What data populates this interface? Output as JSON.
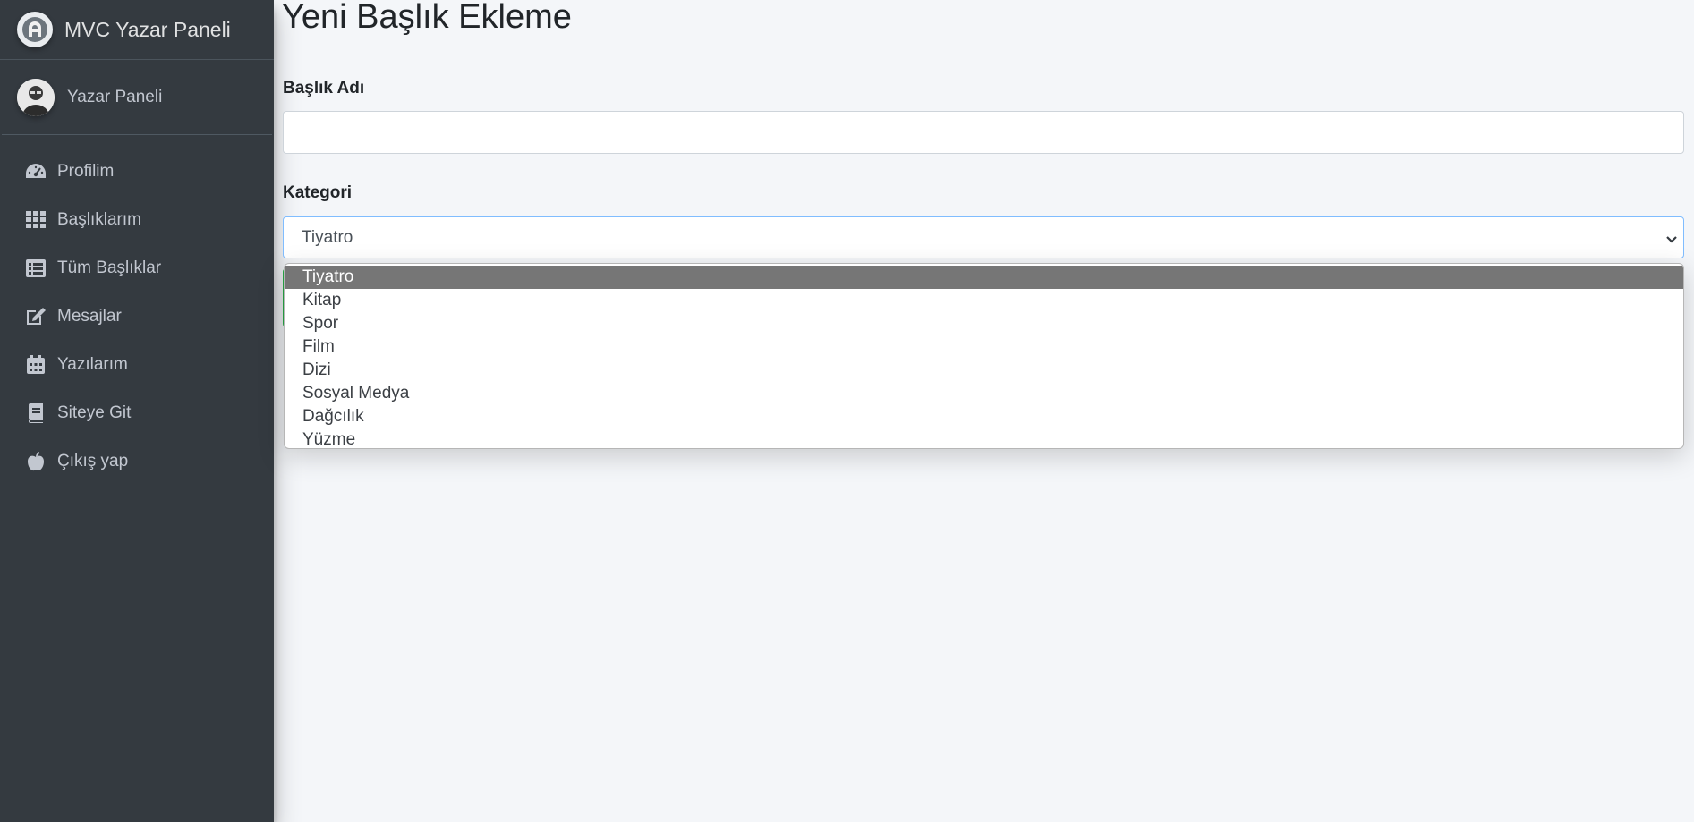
{
  "sidebar": {
    "brand": "MVC Yazar Paneli",
    "user_name": "Yazar Paneli",
    "items": [
      {
        "label": "Profilim",
        "icon": "tachometer-icon"
      },
      {
        "label": "Başlıklarım",
        "icon": "grid-icon"
      },
      {
        "label": "Tüm Başlıklar",
        "icon": "list-icon"
      },
      {
        "label": "Mesajlar",
        "icon": "edit-icon"
      },
      {
        "label": "Yazılarım",
        "icon": "calendar-icon"
      },
      {
        "label": "Siteye Git",
        "icon": "book-icon"
      },
      {
        "label": "Çıkış yap",
        "icon": "apple-icon"
      }
    ]
  },
  "main": {
    "title": "Yeni Başlık Ekleme",
    "title_field_label": "Başlık Adı",
    "title_field_value": "",
    "category_label": "Kategori",
    "category_selected": "Tiyatro",
    "category_options": [
      "Tiyatro",
      "Kitap",
      "Spor",
      "Film",
      "Dizi",
      "Sosyal Medya",
      "Dağcılık",
      "Yüzme"
    ]
  },
  "colors": {
    "sidebar_bg": "#343a40",
    "content_bg": "#f4f6f9",
    "focus_border": "#80bdff",
    "option_highlight": "#767676"
  }
}
